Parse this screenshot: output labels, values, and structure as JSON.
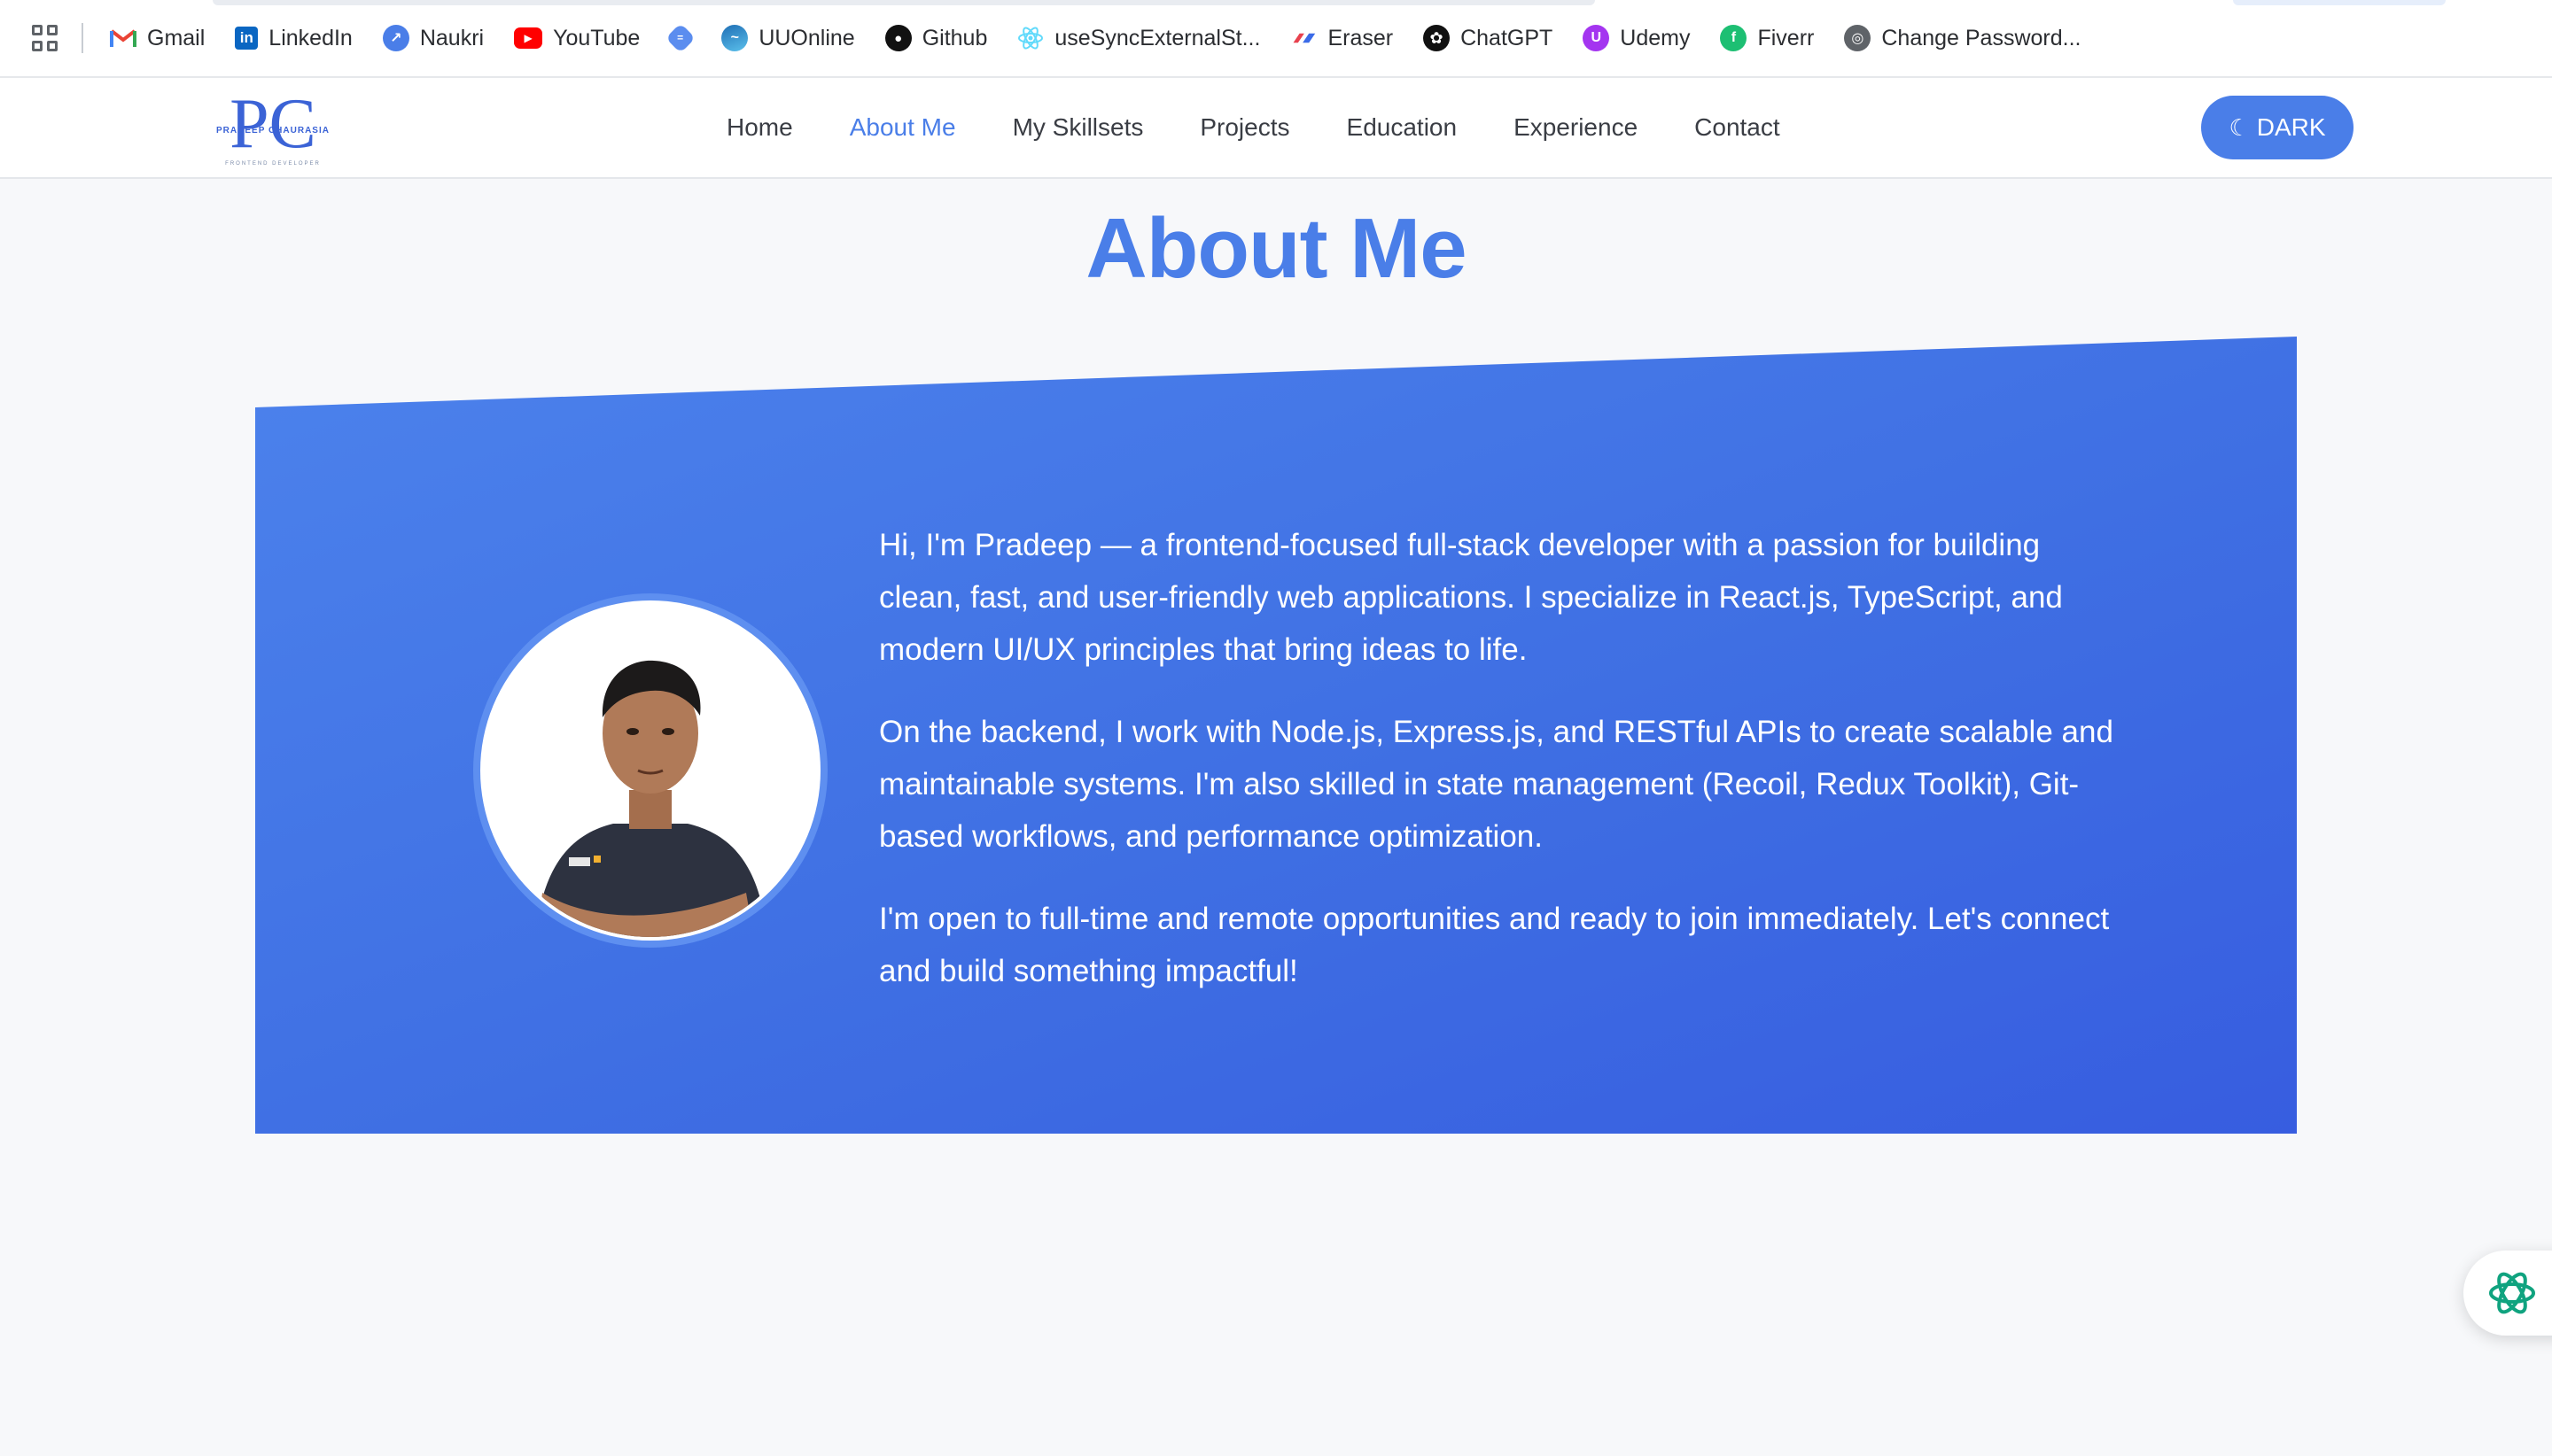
{
  "bookmarks": [
    {
      "label": "Gmail",
      "icon": "gmail-icon",
      "color": "#ea4335"
    },
    {
      "label": "LinkedIn",
      "icon": "linkedin-icon",
      "color": "#0a66c2"
    },
    {
      "label": "Naukri",
      "icon": "naukri-icon",
      "color": "#4a7ee8"
    },
    {
      "label": "YouTube",
      "icon": "youtube-icon",
      "color": "#ff0000"
    },
    {
      "label": "",
      "icon": "cloud-icon",
      "color": "#5b8def"
    },
    {
      "label": "UUOnline",
      "icon": "uuonline-icon",
      "color": "#1f6fb5"
    },
    {
      "label": "Github",
      "icon": "github-icon",
      "color": "#111111"
    },
    {
      "label": "useSyncExternalSt...",
      "icon": "react-icon",
      "color": "#61dafb"
    },
    {
      "label": "Eraser",
      "icon": "eraser-icon",
      "color": "#e8414e"
    },
    {
      "label": "ChatGPT",
      "icon": "chatgpt-icon",
      "color": "#111111"
    },
    {
      "label": "Udemy",
      "icon": "udemy-icon",
      "color": "#a435f0"
    },
    {
      "label": "Fiverr",
      "icon": "fiverr-icon",
      "color": "#1dbf73"
    },
    {
      "label": "Change Password...",
      "icon": "globe-icon",
      "color": "#5f6368"
    }
  ],
  "header": {
    "logo": {
      "initials": "PC",
      "name": "PRADEEP CHAURASIA",
      "subtitle": "FRONTEND DEVELOPER"
    },
    "nav": [
      "Home",
      "About Me",
      "My Skillsets",
      "Projects",
      "Education",
      "Experience",
      "Contact"
    ],
    "active_nav": "About Me",
    "theme_button": "DARK"
  },
  "about": {
    "title": "About Me",
    "paragraphs": [
      "Hi, I'm Pradeep — a frontend-focused full-stack developer with a passion for building clean, fast, and user-friendly web applications. I specialize in React.js, TypeScript, and modern UI/UX principles that bring ideas to life.",
      "On the backend, I work with Node.js, Express.js, and RESTful APIs to create scalable and maintainable systems. I'm also skilled in state management (Recoil, Redux Toolkit), Git-based workflows, and performance optimization.",
      "I'm open to full-time and remote opportunities and ready to join immediately. Let's connect and build something impactful!"
    ]
  },
  "colors": {
    "accent": "#4a7ee8",
    "card": "#4070e4"
  }
}
